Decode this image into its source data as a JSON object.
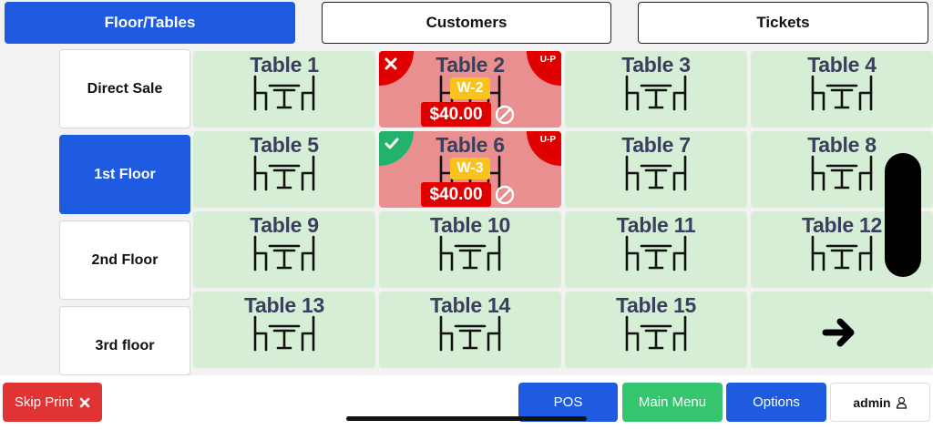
{
  "tabs": [
    {
      "label": "Floor/Tables",
      "active": true
    },
    {
      "label": "Customers",
      "active": false
    },
    {
      "label": "Tickets",
      "active": false
    }
  ],
  "floors": [
    {
      "label": "Direct Sale",
      "active": false
    },
    {
      "label": "1st Floor",
      "active": true
    },
    {
      "label": "2nd Floor",
      "active": false
    },
    {
      "label": "3rd floor",
      "active": false
    }
  ],
  "tables": [
    {
      "name": "Table 1"
    },
    {
      "name": "Table 2",
      "waiter": "W-2",
      "amount": "$40.00",
      "tag": "U-P",
      "status": "cancelled"
    },
    {
      "name": "Table 3"
    },
    {
      "name": "Table 4"
    },
    {
      "name": "Table 5"
    },
    {
      "name": "Table 6",
      "waiter": "W-3",
      "amount": "$40.00",
      "tag": "U-P",
      "status": "confirmed"
    },
    {
      "name": "Table 7"
    },
    {
      "name": "Table 8"
    },
    {
      "name": "Table 9"
    },
    {
      "name": "Table 10"
    },
    {
      "name": "Table 11"
    },
    {
      "name": "Table 12"
    },
    {
      "name": "Table 13"
    },
    {
      "name": "Table 14"
    },
    {
      "name": "Table 15"
    }
  ],
  "next_page_icon": "arrow-right-icon",
  "bottom": {
    "skip_print": "Skip Print",
    "pos": "POS",
    "main_menu": "Main Menu",
    "options": "Options",
    "user": "admin"
  },
  "colors": {
    "primary": "#1f5be0",
    "free_table": "#d6eed6",
    "occupied_table": "#ea8f8f",
    "danger": "#e00000",
    "success": "#23b26b",
    "waiter_badge": "#f9c31c"
  }
}
